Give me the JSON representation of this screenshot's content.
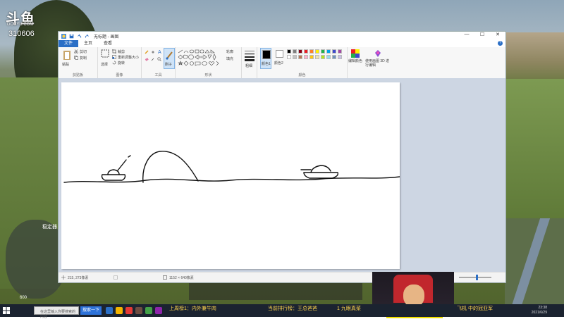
{
  "overlay": {
    "logo_text": "斗鱼",
    "site": "DOUYU.COM",
    "room_id": "310606",
    "minimap_label": "稳定器",
    "minimap_stat": "600",
    "webcam": "streamer-webcam"
  },
  "paint": {
    "title": "无标题 - 画图",
    "window_controls": [
      "—",
      "☐",
      "✕"
    ],
    "tabs": [
      {
        "label": "文件",
        "active": true
      },
      {
        "label": "主页",
        "active": false
      },
      {
        "label": "查看",
        "active": false
      }
    ],
    "ribbon": {
      "clipboard": {
        "paste": "粘贴",
        "cut": "剪切",
        "copy": "复制",
        "label": "剪贴板"
      },
      "image": {
        "select": "选择",
        "crop": "裁剪",
        "resize": "重新调整大小",
        "rotate": "旋转",
        "label": "图像"
      },
      "tools": {
        "brushes": "刷子",
        "label": "工具"
      },
      "shapes": {
        "outline": "轮廓",
        "fill": "填充",
        "label": "形状"
      },
      "size": {
        "label": "粗细"
      },
      "colors": {
        "color1": "颜色1",
        "color2": "颜色2",
        "edit": "编辑颜色",
        "label": "颜色",
        "palette_row1": [
          "#000000",
          "#7f7f7f",
          "#880015",
          "#ed1c24",
          "#ff7f27",
          "#fff200",
          "#22b14c",
          "#00a2e8",
          "#3f48cc",
          "#a349a4"
        ],
        "palette_row2": [
          "#ffffff",
          "#c3c3c3",
          "#b97a57",
          "#ffaec9",
          "#ffc90e",
          "#efe4b0",
          "#b5e61d",
          "#99d9ea",
          "#7092be",
          "#c8bfe7"
        ]
      },
      "paint3d": {
        "label": "使用画图 3D 进行编辑"
      }
    },
    "status": {
      "cursor": "215, 273像素",
      "canvas_size": "1152 × 640像素"
    }
  },
  "taskbar": {
    "search_placeholder": "在这里输入你要搜索的内容",
    "button": "搜索一下",
    "danmaku": [
      {
        "text": "上周榜1：内外兼牛肉",
        "color": "#ffd54f"
      },
      {
        "text": "当前排行榜：王总爸爸",
        "color": "#ffd54f"
      },
      {
        "text": "1 九眼真菜",
        "color": "#ffd54f"
      },
      {
        "text": "飞机 中的冠亚军",
        "color": "#ffd54f"
      }
    ],
    "time": "23:38",
    "date": "2021/6/29"
  }
}
